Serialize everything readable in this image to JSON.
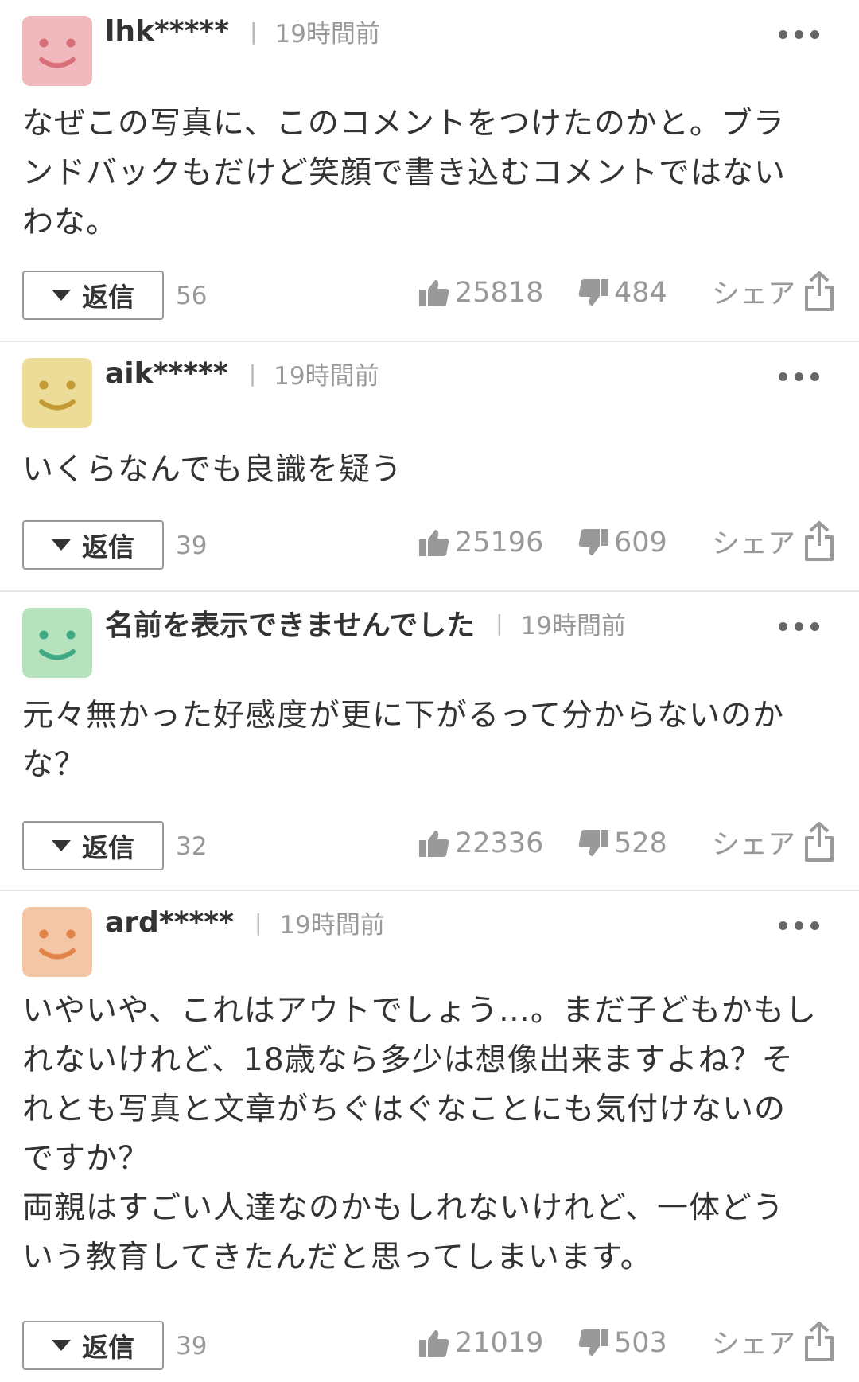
{
  "comments": [
    {
      "username": "lhk*****",
      "time": "19時間前",
      "avatar_color": "#f1b9bd",
      "avatar_feature_color": "#d86f79",
      "text_lines": [
        "なぜこの写真に、このコメントをつけたのかと。ブラ",
        "ンドバックもだけど笑顔で書き込むコメントではない",
        "わな。"
      ],
      "reply_label": "返信",
      "reply_count": "56",
      "likes": "25818",
      "dislikes": "484",
      "share_label": "シェア"
    },
    {
      "username": "aik*****",
      "time": "19時間前",
      "avatar_color": "#ecdc98",
      "avatar_feature_color": "#c39a33",
      "text_lines": [
        "いくらなんでも良識を疑う"
      ],
      "reply_label": "返信",
      "reply_count": "39",
      "likes": "25196",
      "dislikes": "609",
      "share_label": "シェア"
    },
    {
      "username": "名前を表示できませんでした",
      "time": "19時間前",
      "avatar_color": "#b6e2be",
      "avatar_feature_color": "#3fa983",
      "text_lines": [
        "元々無かった好感度が更に下がるって分からないのか",
        "な？"
      ],
      "reply_label": "返信",
      "reply_count": "32",
      "likes": "22336",
      "dislikes": "528",
      "share_label": "シェア"
    },
    {
      "username": "ard*****",
      "time": "19時間前",
      "avatar_color": "#f3c6a5",
      "avatar_feature_color": "#e2834a",
      "text_lines": [
        "いやいや、これはアウトでしょう…。まだ子どもかもし",
        "れないけれど、18歳なら多少は想像出来ますよね？そ",
        "れとも写真と文章がちぐはぐなことにも気付けないの",
        "ですか？",
        "両親はすごい人達なのかもしれないけれど、一体どう",
        "いう教育してきたんだと思ってしまいます。"
      ],
      "reply_label": "返信",
      "reply_count": "39",
      "likes": "21019",
      "dislikes": "503",
      "share_label": "シェア"
    }
  ]
}
